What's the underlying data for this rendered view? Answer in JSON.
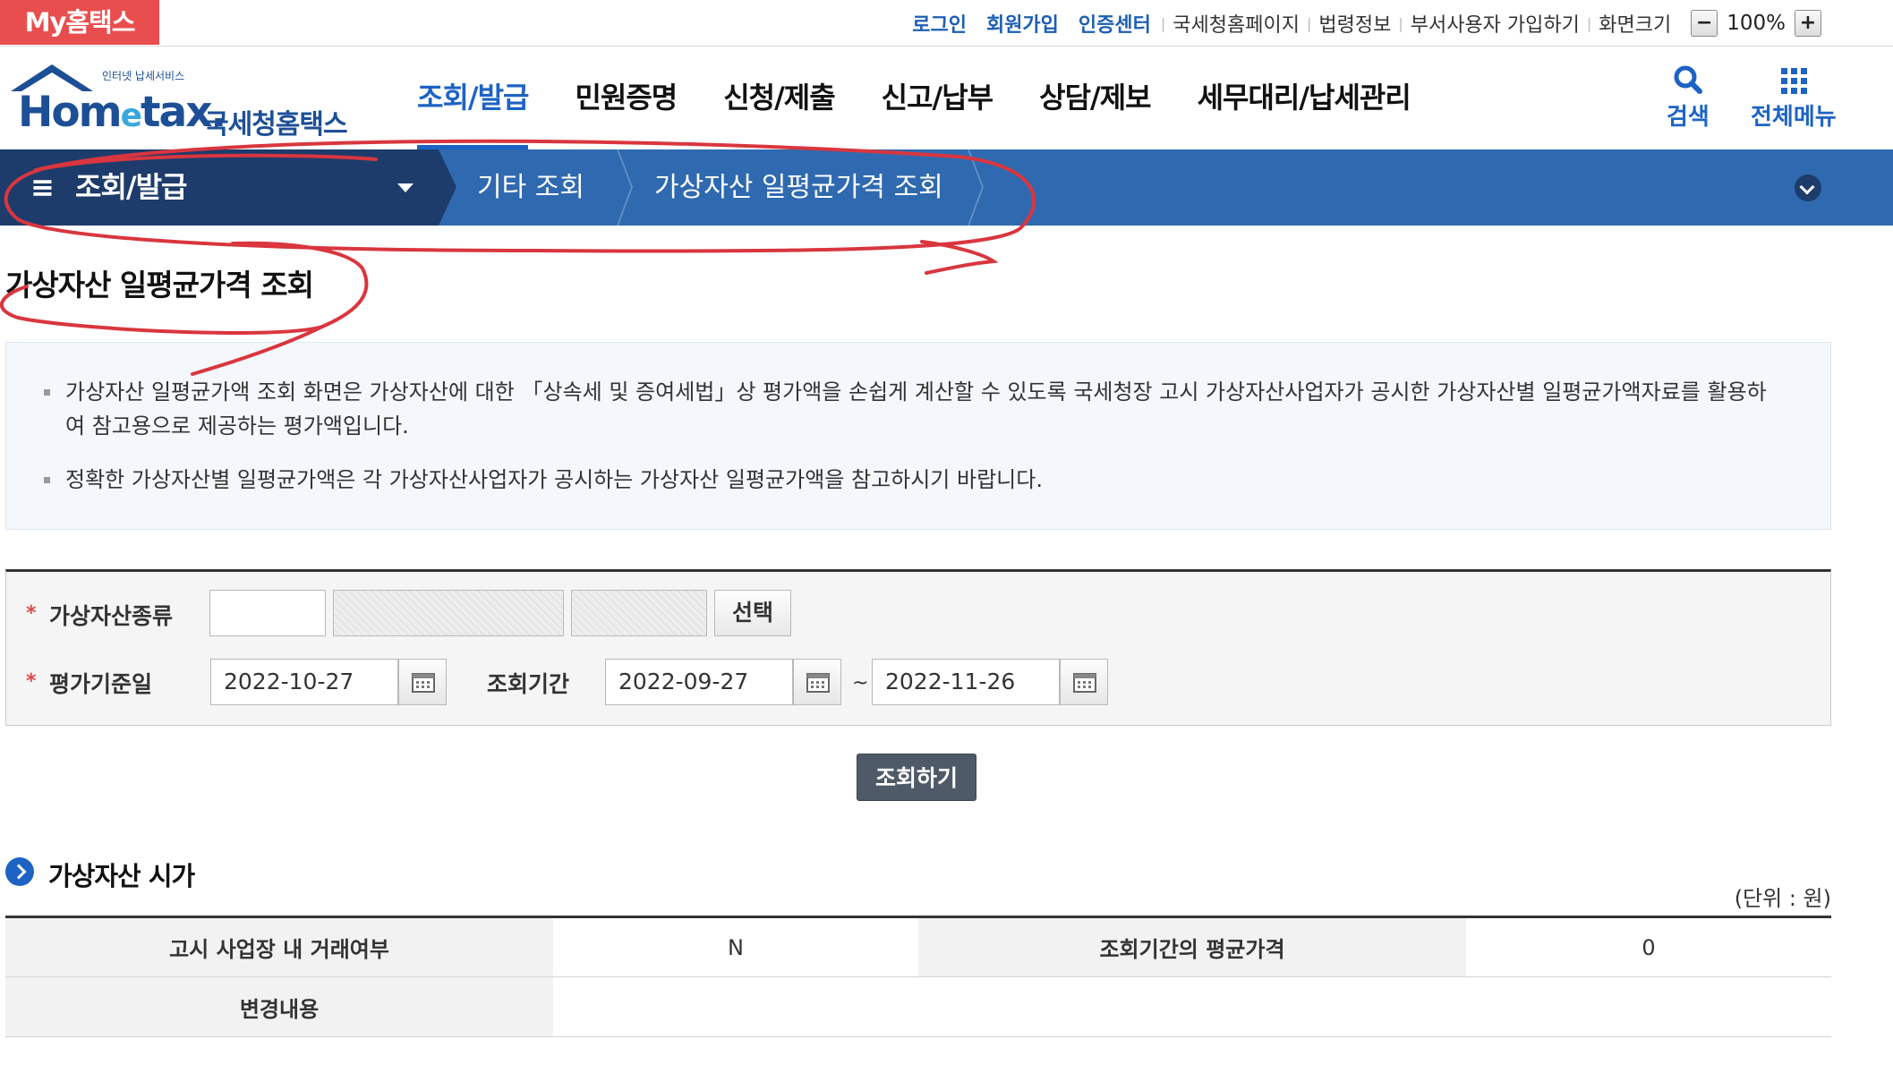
{
  "topbar": {
    "my_button": "My홈택스",
    "login": "로그인",
    "signup": "회원가입",
    "cert_center": "인증센터",
    "nts_home": "국세청홈페이지",
    "law_info": "법령정보",
    "dept_signup": "부서사용자 가입하기",
    "screen_size": "화면크기",
    "zoom_minus": "−",
    "zoom_value": "100%",
    "zoom_plus": "+"
  },
  "header": {
    "logo_small": "인터넷 납세서비스",
    "logo_home": "Hom",
    "logo_e": "e",
    "logo_tax": "tax.",
    "logo_kor": "국세청홈택스",
    "nav": [
      "조회/발급",
      "민원증명",
      "신청/제출",
      "신고/납부",
      "상담/제보",
      "세무대리/납세관리"
    ],
    "search_label": "검색",
    "allmenu_label": "전체메뉴",
    "search_icon": "search-icon",
    "grid_icon": "grid-icon"
  },
  "location": {
    "menu_glyph": "≡",
    "first": "조회/발급",
    "second": "기타 조회",
    "third": "가상자산 일평균가격 조회"
  },
  "page": {
    "title": "가상자산 일평균가격 조회",
    "info_line1": "가상자산 일평균가액 조회 화면은 가상자산에 대한 「상속세 및 증여세법」상 평가액을 손쉽게 계산할 수 있도록 국세청장 고시 가상자산사업자가 공시한 가상자산별 일평균가액자료를 활용하",
    "info_line1b": "여 참고용으로 제공하는 평가액입니다.",
    "info_line2": "정확한 가상자산별 일평균가액은 각 가상자산사업자가 공시하는 가상자산 일평균가액을 참고하시기 바랍니다."
  },
  "form": {
    "required_mark": "*",
    "asset_type_label": "가상자산종류",
    "asset_type_value": "",
    "select_button": "선택",
    "eval_date_label": "평가기준일",
    "eval_date_value": "2022-10-27",
    "period_label": "조회기간",
    "period_start": "2022-09-27",
    "period_tilde": "~",
    "period_end": "2022-11-26",
    "search_button": "조회하기"
  },
  "result": {
    "section_title": "가상자산 시가",
    "unit": "(단위 : 원)",
    "row1_label1": "고시 사업장 내 거래여부",
    "row1_value1": "N",
    "row1_label2": "조회기간의 평균가격",
    "row1_value2": "0",
    "row2_label": "변경내용",
    "row2_value": ""
  },
  "colors": {
    "accent": "#1d63c4",
    "location_bar": "#2f6ab0",
    "location_first": "#1d3c6b",
    "my_button": "#e94e4e",
    "annotation": "#d9363e"
  }
}
